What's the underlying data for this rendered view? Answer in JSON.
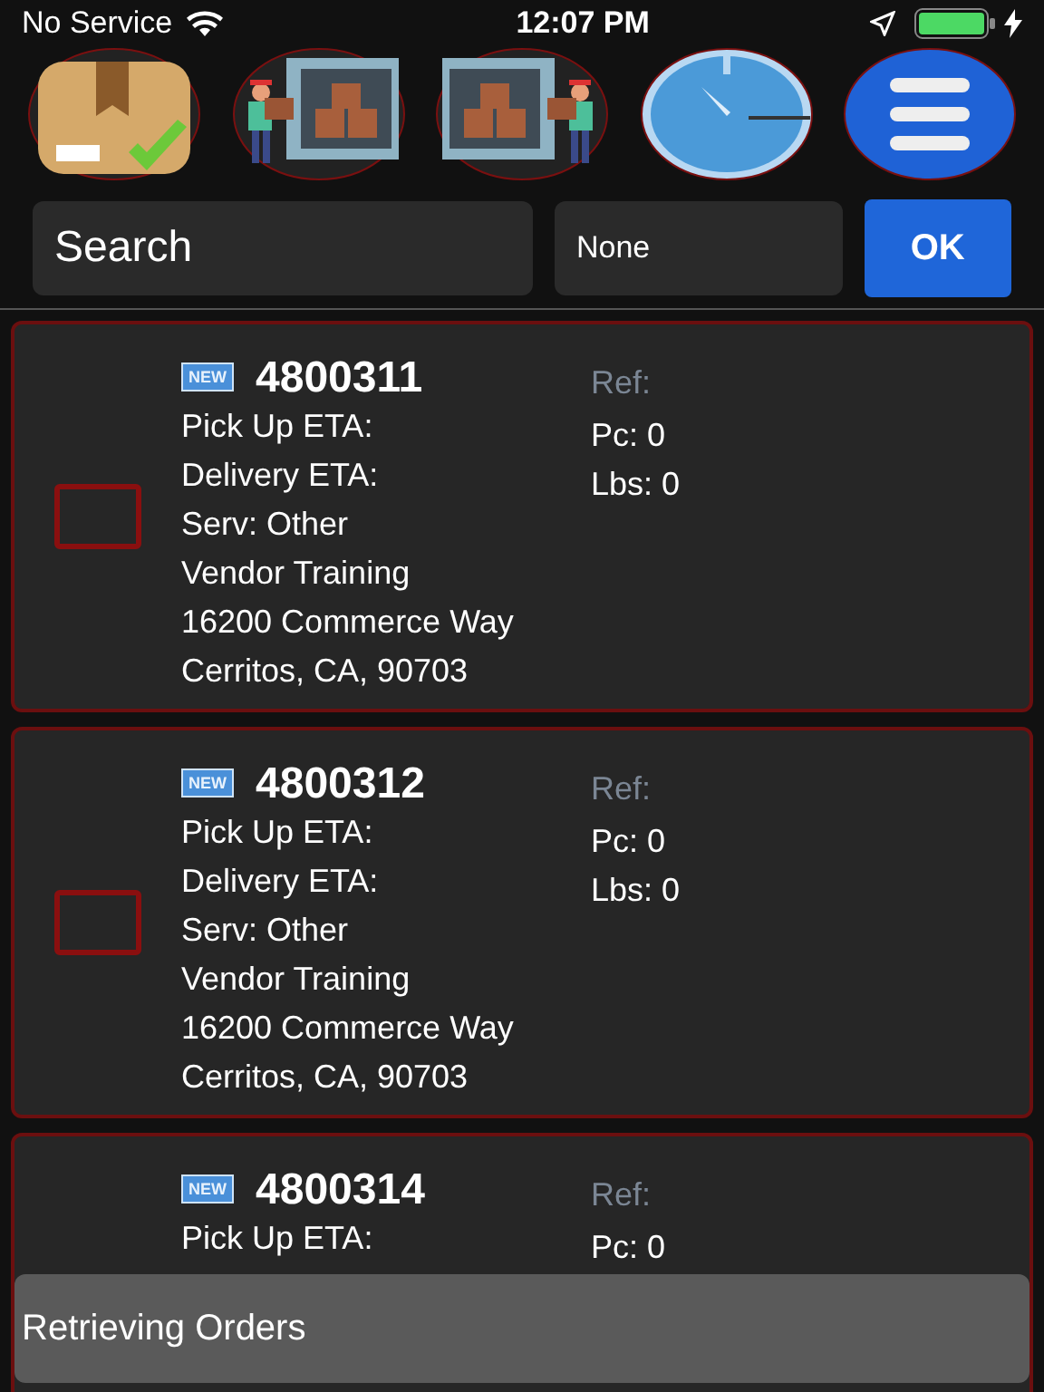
{
  "status_bar": {
    "carrier": "No Service",
    "time": "12:07 PM"
  },
  "search": {
    "placeholder": "Search",
    "filter": "None",
    "button": "OK"
  },
  "orders": [
    {
      "badge": "NEW",
      "number": "4800311",
      "ref": "Ref:",
      "checked": false,
      "left": [
        "Pick Up ETA:",
        "Delivery ETA:",
        "Serv: Other",
        "Vendor Training",
        "16200 Commerce Way",
        "Cerritos, CA, 90703"
      ],
      "right": [
        "Pc: 0",
        "Lbs: 0"
      ]
    },
    {
      "badge": "NEW",
      "number": "4800312",
      "ref": "Ref:",
      "checked": false,
      "left": [
        "Pick Up ETA:",
        "Delivery ETA:",
        "Serv: Other",
        "Vendor Training",
        "16200 Commerce Way",
        "Cerritos, CA, 90703"
      ],
      "right": [
        "Pc: 0",
        "Lbs: 0"
      ]
    },
    {
      "badge": "NEW",
      "number": "4800314",
      "ref": "Ref:",
      "left": [
        "Pick Up ETA:"
      ],
      "right": [
        "Pc: 0"
      ]
    }
  ],
  "toast": "Retrieving Orders"
}
